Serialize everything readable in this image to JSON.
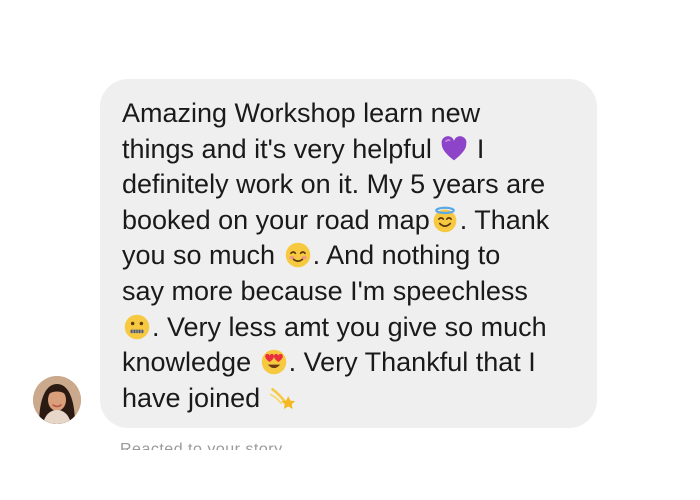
{
  "message": {
    "lines": [
      "Amazing Workshop learn new",
      "things and it's very helpful",
      "I",
      "definitely work on it. My 5 years are",
      "booked on your road map",
      ". Thank",
      "you so much",
      ". And nothing to",
      "say more because I'm speechless",
      ". Very less amt you give so much",
      "knowledge",
      ". Very Thankful that I",
      "have joined"
    ],
    "emojis": {
      "heart": "purple-heart-icon",
      "halo": "smiling-halo-icon",
      "blush": "smiling-blush-icon",
      "zipper": "zipper-mouth-icon",
      "heart_eyes": "heart-eyes-icon",
      "dizzy": "dizzy-icon"
    }
  },
  "sender": {
    "avatar": "sender-avatar"
  },
  "footer": {
    "cutoff_text": "Reacted to your story"
  },
  "colors": {
    "bubble": "#efefef",
    "text": "#1a1a1a",
    "background": "#ffffff"
  }
}
